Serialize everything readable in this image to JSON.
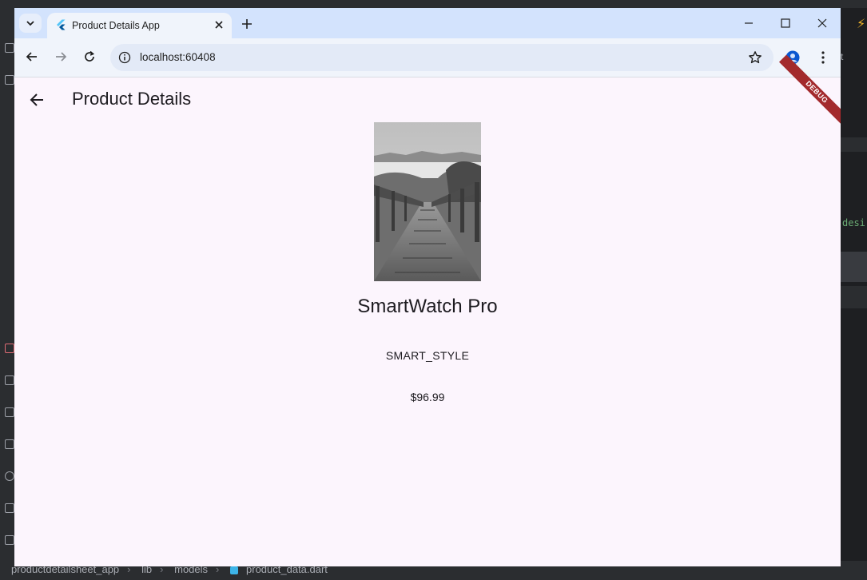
{
  "browser": {
    "tab_title": "Product Details App",
    "url": "localhost:60408"
  },
  "app": {
    "appbar_title": "Product Details",
    "debug_banner": "DEBUG",
    "product": {
      "name": "SmartWatch Pro",
      "brand": "SMART_STYLE",
      "price": "$96.99"
    }
  },
  "ide": {
    "breadcrumbs": [
      "productdetailsheet_app",
      "lib",
      "models",
      "product_data.dart"
    ],
    "code_fragment": "desi",
    "tab_fragment": "t"
  },
  "icons": {
    "tab_menu": "chevron-down-icon",
    "favicon": "flutter-logo-icon",
    "tab_close": "close-icon",
    "new_tab": "plus-icon",
    "minimize": "minimize-icon",
    "maximize": "maximize-icon",
    "window_close": "close-icon",
    "back": "arrow-left-icon",
    "forward": "arrow-right-icon",
    "reload": "reload-icon",
    "site_info": "info-icon",
    "bookmark": "star-icon",
    "profile": "account-icon",
    "menu": "more-vert-icon"
  },
  "colors": {
    "tabstrip": "#d3e3fd",
    "toolbar": "#f0f4fb",
    "app_background": "#fcf5fd",
    "debug_banner": "#a32a2d",
    "text": "#1d1b20"
  }
}
